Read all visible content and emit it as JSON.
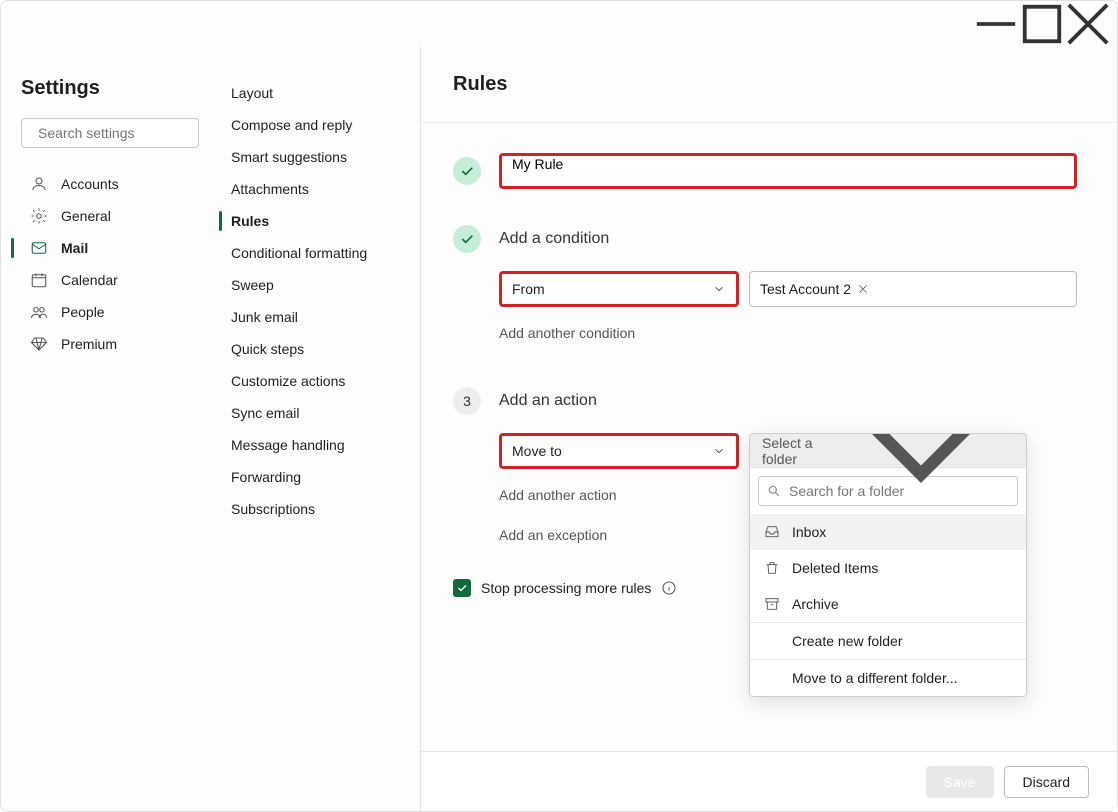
{
  "window": {
    "minimize_label": "Minimize",
    "maximize_label": "Maximize",
    "close_label": "Close"
  },
  "sidebar": {
    "title": "Settings",
    "search_placeholder": "Search settings",
    "items": [
      {
        "label": "Accounts",
        "icon": "person-icon"
      },
      {
        "label": "General",
        "icon": "gear-icon"
      },
      {
        "label": "Mail",
        "icon": "mail-icon",
        "selected": true
      },
      {
        "label": "Calendar",
        "icon": "calendar-icon"
      },
      {
        "label": "People",
        "icon": "people-icon"
      },
      {
        "label": "Premium",
        "icon": "diamond-icon"
      }
    ]
  },
  "subnav": {
    "items": [
      {
        "label": "Layout"
      },
      {
        "label": "Compose and reply"
      },
      {
        "label": "Smart suggestions"
      },
      {
        "label": "Attachments"
      },
      {
        "label": "Rules",
        "selected": true
      },
      {
        "label": "Conditional formatting"
      },
      {
        "label": "Sweep"
      },
      {
        "label": "Junk email"
      },
      {
        "label": "Quick steps"
      },
      {
        "label": "Customize actions"
      },
      {
        "label": "Sync email"
      },
      {
        "label": "Message handling"
      },
      {
        "label": "Forwarding"
      },
      {
        "label": "Subscriptions"
      }
    ]
  },
  "main": {
    "title": "Rules",
    "rule_name": "My Rule",
    "step2": {
      "heading": "Add a condition",
      "condition_type": "From",
      "token": "Test Account 2",
      "add_another": "Add another condition"
    },
    "step3": {
      "num": "3",
      "heading": "Add an action",
      "action_type": "Move to",
      "folder_placeholder": "Select a folder",
      "add_another_action": "Add another action",
      "add_exception": "Add an exception"
    },
    "stop_processing": "Stop processing more rules",
    "folder_dropdown": {
      "search_placeholder": "Search for a folder",
      "items": [
        {
          "label": "Inbox",
          "icon": "inbox-icon",
          "highlight": true
        },
        {
          "label": "Deleted Items",
          "icon": "trash-icon"
        },
        {
          "label": "Archive",
          "icon": "archive-icon"
        }
      ],
      "create_new": "Create new folder",
      "move_different": "Move to a different folder..."
    }
  },
  "footer": {
    "save": "Save",
    "discard": "Discard"
  }
}
